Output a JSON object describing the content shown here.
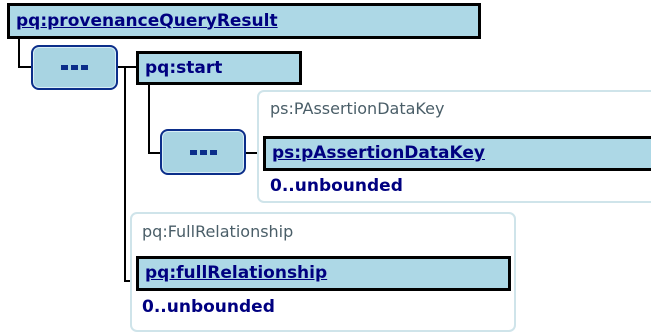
{
  "root": {
    "name": "pq:provenanceQueryResult"
  },
  "start": {
    "name": "pq:start"
  },
  "passertion": {
    "type": "ps:PAssertionDataKey",
    "name": "ps:pAssertionDataKey",
    "occurrence": "0..unbounded"
  },
  "relationship": {
    "type": "pq:FullRelationship",
    "name": "pq:fullRelationship",
    "occurrence": "0..unbounded"
  },
  "sequence": {
    "icon": "sequence-compositor-icon"
  },
  "colors": {
    "element_fill": "#add8e6",
    "element_text": "#000080",
    "compositor_border": "#0c2e8a",
    "type_frame": "#cfe4ea",
    "type_text": "#4a5e68"
  }
}
